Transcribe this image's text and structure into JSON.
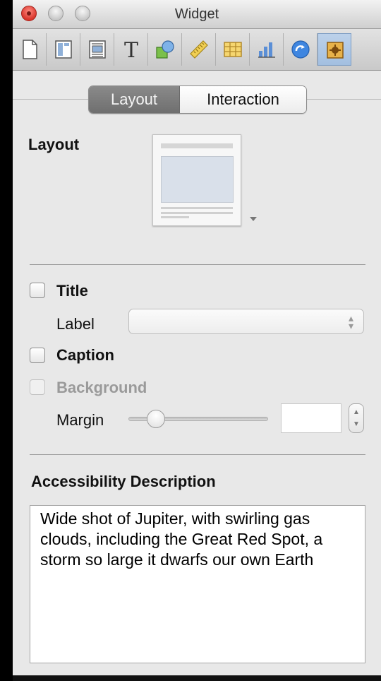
{
  "window": {
    "title": "Widget"
  },
  "toolbar": {
    "items": [
      {
        "icon": "document-icon"
      },
      {
        "icon": "layout-icon"
      },
      {
        "icon": "text-wrap-icon"
      },
      {
        "icon": "text-icon"
      },
      {
        "icon": "shapes-icon"
      },
      {
        "icon": "ruler-icon"
      },
      {
        "icon": "table-icon"
      },
      {
        "icon": "chart-icon"
      },
      {
        "icon": "link-icon"
      },
      {
        "icon": "widget-icon",
        "active": true
      }
    ]
  },
  "tabs": {
    "layout": "Layout",
    "interaction": "Interaction"
  },
  "layout_section": {
    "label": "Layout"
  },
  "options": {
    "title_label": "Title",
    "label_label": "Label",
    "label_value": "",
    "caption_label": "Caption",
    "background_label": "Background",
    "margin_label": "Margin",
    "margin_value": "",
    "margin_slider_level": 0.15
  },
  "accessibility": {
    "heading": "Accessibility Description",
    "text": "Wide shot of Jupiter, with swirling gas clouds, including the Great Red Spot, a storm so large it dwarfs our own Earth"
  },
  "colors": {
    "active_tool": "#a3bfe0",
    "selected_tab": "#6f6f6f"
  }
}
